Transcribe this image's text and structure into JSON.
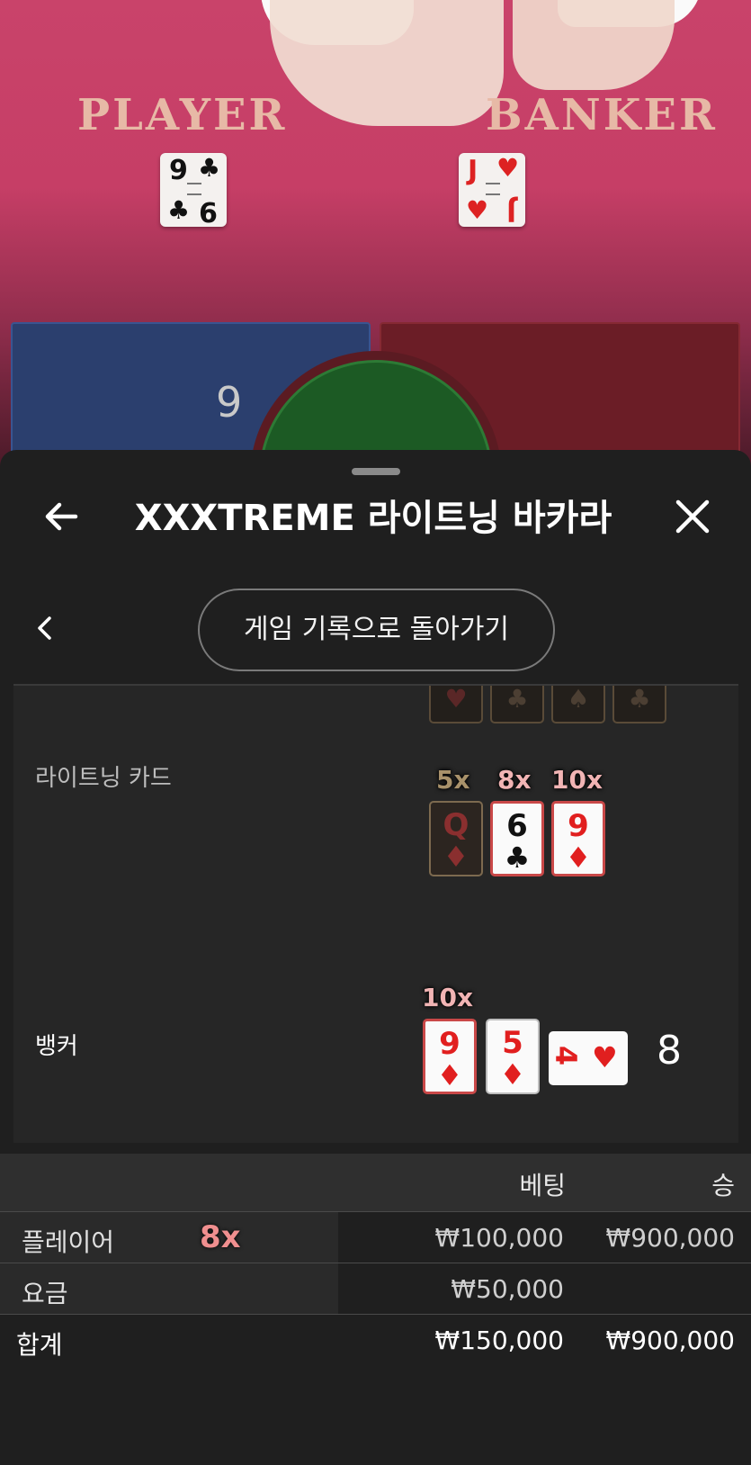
{
  "table": {
    "player_label": "PLAYER",
    "banker_label": "BANKER",
    "player_card": {
      "rank": "9",
      "suit": "♣"
    },
    "banker_card": {
      "rank": "J",
      "suit": "♥"
    },
    "player_score": "9"
  },
  "header": {
    "title": "XXXTREME 라이트닝 바카라",
    "back_icon": "arrow-left-icon",
    "close_icon": "close-icon"
  },
  "nav": {
    "back_to_history_label": "게임 기록으로 돌아가기",
    "back_icon": "chevron-left-icon"
  },
  "result": {
    "faded_suits": [
      "♥",
      "♣",
      "♠",
      "♣"
    ],
    "lightning_label": "라이트닝 카드",
    "lightning_cards": [
      {
        "multiplier": "5x",
        "rank": "Q",
        "suit": "♦",
        "dim": true
      },
      {
        "multiplier": "8x",
        "rank": "6",
        "suit": "♣",
        "dim": false
      },
      {
        "multiplier": "10x",
        "rank": "9",
        "suit": "♦",
        "dim": false
      }
    ],
    "banker_label": "뱅커",
    "banker_cards": [
      {
        "multiplier": "10x",
        "rank": "9",
        "suit": "♦"
      },
      {
        "multiplier": "",
        "rank": "5",
        "suit": "♦"
      },
      {
        "multiplier": "",
        "rank": "4",
        "suit": "♥"
      }
    ],
    "banker_total": "8"
  },
  "summary": {
    "columns": {
      "bet": "베팅",
      "win": "승"
    },
    "rows": [
      {
        "label": "플레이어",
        "multiplier": "8x",
        "bet": "₩100,000",
        "win": "₩900,000"
      },
      {
        "label": "요금",
        "multiplier": "",
        "bet": "₩50,000",
        "win": ""
      }
    ],
    "total": {
      "label": "합계",
      "bet": "₩150,000",
      "win": "₩900,000"
    }
  }
}
